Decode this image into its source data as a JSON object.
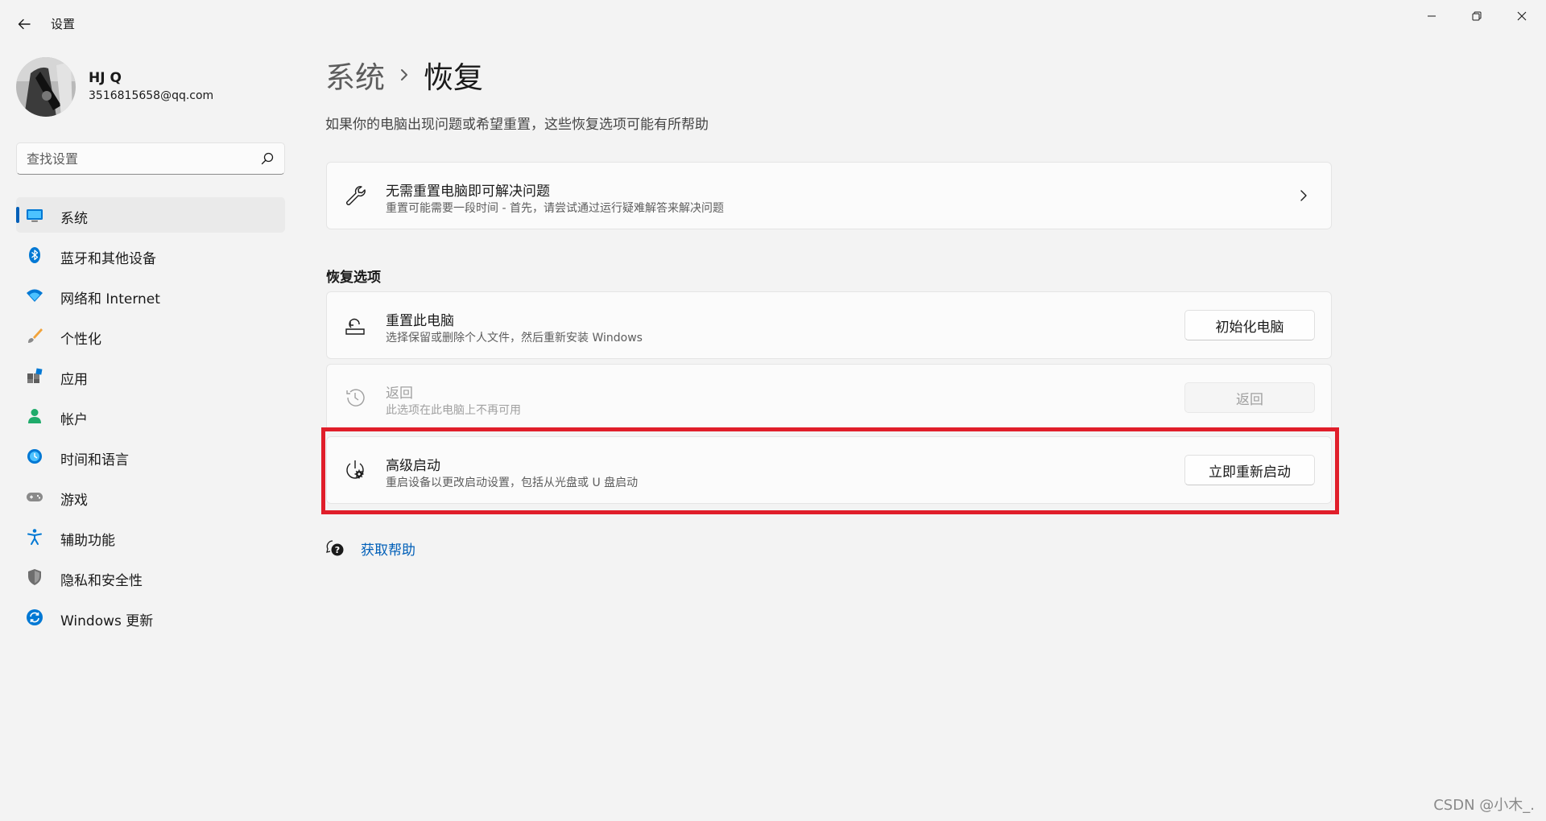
{
  "window": {
    "title": "设置"
  },
  "user": {
    "name": "HJ Q",
    "email": "3516815658@qq.com"
  },
  "search": {
    "placeholder": "查找设置",
    "value": ""
  },
  "sidebar": {
    "items": [
      {
        "label": "系统",
        "icon": "system-icon",
        "selected": true
      },
      {
        "label": "蓝牙和其他设备",
        "icon": "bluetooth-icon"
      },
      {
        "label": "网络和 Internet",
        "icon": "wifi-icon"
      },
      {
        "label": "个性化",
        "icon": "brush-icon"
      },
      {
        "label": "应用",
        "icon": "apps-icon"
      },
      {
        "label": "帐户",
        "icon": "account-icon"
      },
      {
        "label": "时间和语言",
        "icon": "globe-clock-icon"
      },
      {
        "label": "游戏",
        "icon": "gamepad-icon"
      },
      {
        "label": "辅助功能",
        "icon": "accessibility-icon"
      },
      {
        "label": "隐私和安全性",
        "icon": "shield-icon"
      },
      {
        "label": "Windows 更新",
        "icon": "update-icon"
      }
    ]
  },
  "breadcrumb": {
    "parent": "系统",
    "current": "恢复"
  },
  "page": {
    "subtitle": "如果你的电脑出现问题或希望重置，这些恢复选项可能有所帮助"
  },
  "fix_card": {
    "title": "无需重置电脑即可解决问题",
    "description": "重置可能需要一段时间 - 首先，请尝试通过运行疑难解答来解决问题"
  },
  "recovery_section": {
    "heading": "恢复选项",
    "reset": {
      "title": "重置此电脑",
      "description": "选择保留或删除个人文件，然后重新安装 Windows",
      "button": "初始化电脑"
    },
    "go_back": {
      "title": "返回",
      "description": "此选项在此电脑上不再可用",
      "button": "返回"
    },
    "advanced": {
      "title": "高级启动",
      "description": "重启设备以更改启动设置，包括从光盘或 U 盘启动",
      "button": "立即重新启动"
    }
  },
  "help": {
    "label": "获取帮助"
  },
  "watermark": "CSDN @小木_.",
  "colors": {
    "accent": "#005fb8",
    "highlight": "#e01e2a",
    "background": "#f3f3f3"
  }
}
